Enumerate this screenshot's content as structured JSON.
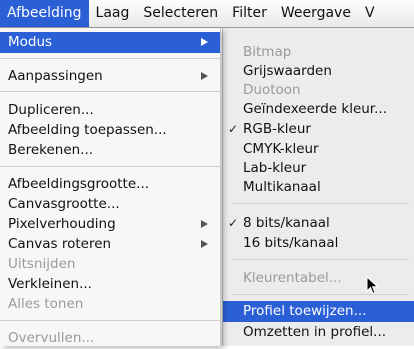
{
  "menubar": {
    "items": [
      {
        "label": "Afbeelding"
      },
      {
        "label": "Laag"
      },
      {
        "label": "Selecteren"
      },
      {
        "label": "Filter"
      },
      {
        "label": "Weergave"
      },
      {
        "label": "V"
      }
    ]
  },
  "main_menu": {
    "items": [
      {
        "label": "Modus"
      },
      {
        "label": "Aanpassingen"
      },
      {
        "label": "Dupliceren..."
      },
      {
        "label": "Afbeelding toepassen..."
      },
      {
        "label": "Berekenen..."
      },
      {
        "label": "Afbeeldingsgrootte..."
      },
      {
        "label": "Canvasgrootte..."
      },
      {
        "label": "Pixelverhouding"
      },
      {
        "label": "Canvas roteren"
      },
      {
        "label": "Uitsnijden"
      },
      {
        "label": "Verkleinen..."
      },
      {
        "label": "Alles tonen"
      },
      {
        "label": "Overvullen..."
      }
    ]
  },
  "sub_menu": {
    "items": [
      {
        "label": "Bitmap"
      },
      {
        "label": "Grijswaarden"
      },
      {
        "label": "Duotoon"
      },
      {
        "label": "Geïndexeerde kleur..."
      },
      {
        "label": "RGB-kleur"
      },
      {
        "label": "CMYK-kleur"
      },
      {
        "label": "Lab-kleur"
      },
      {
        "label": "Multikanaal"
      },
      {
        "label": "8 bits/kanaal"
      },
      {
        "label": "16 bits/kanaal"
      },
      {
        "label": "Kleurentabel..."
      },
      {
        "label": "Profiel toewijzen..."
      },
      {
        "label": "Omzetten in profiel..."
      }
    ]
  },
  "colors": {
    "selection": "#2a5fd6",
    "disabled_text": "#9a9a9a"
  }
}
